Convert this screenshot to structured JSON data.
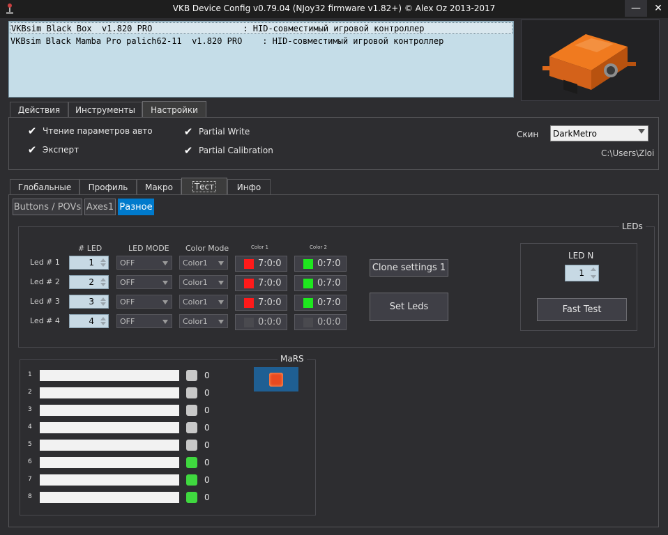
{
  "window": {
    "title": "VKB Device Config v0.79.04 (NJoy32 firmware v1.82+) © Alex Oz 2013-2017",
    "minimize_icon": "minimize-icon",
    "close_icon": "close-icon"
  },
  "devices": [
    {
      "text": "VKBsim Black Box  v1.820 PRO                  : HID-совместимый игровой контроллер"
    },
    {
      "text": "VKBsim Black Mamba Pro palich62-11  v1.820 PRO    : HID-совместимый игровой контроллер"
    }
  ],
  "main_tabs": [
    "Действия",
    "Инструменты",
    "Настройки"
  ],
  "settings": {
    "read_params_auto": "Чтение параметров авто",
    "expert": "Эксперт",
    "partial_write": "Partial Write",
    "partial_calibration": "Partial Calibration",
    "skin_label": "Скин",
    "skin_value": "DarkMetro",
    "path": "C:\\Users\\Zloi"
  },
  "sub_tabs": [
    "Глобальные",
    "Профиль",
    "Макро",
    "Тест",
    "Инфо"
  ],
  "test_tabs": [
    "Buttons / POVs",
    "Axes1",
    "Разное"
  ],
  "leds": {
    "group_title": "LEDs",
    "headers": {
      "num": "# LED",
      "mode": "LED MODE",
      "color_mode": "Color Mode",
      "color1": "Color 1",
      "color2": "Color 2"
    },
    "rows": [
      {
        "label": "Led # 1",
        "num": "1",
        "mode": "OFF",
        "color_mode": "Color1",
        "c1": "7:0:0",
        "c1_color": "#ff1a1a",
        "c2": "0:7:0",
        "c2_color": "#1ee81e"
      },
      {
        "label": "Led # 2",
        "num": "2",
        "mode": "OFF",
        "color_mode": "Color1",
        "c1": "7:0:0",
        "c1_color": "#ff1a1a",
        "c2": "0:7:0",
        "c2_color": "#1ee81e"
      },
      {
        "label": "Led # 3",
        "num": "3",
        "mode": "OFF",
        "color_mode": "Color1",
        "c1": "7:0:0",
        "c1_color": "#ff1a1a",
        "c2": "0:7:0",
        "c2_color": "#1ee81e"
      },
      {
        "label": "Led # 4",
        "num": "4",
        "mode": "OFF",
        "color_mode": "Color1",
        "c1": "0:0:0",
        "c1_color": "#4a4a4f",
        "c2": "0:0:0",
        "c2_color": "#4a4a4f"
      }
    ],
    "clone_button": "Clone settings 1",
    "set_button": "Set Leds",
    "led_n_label": "LED N",
    "led_n_value": "1",
    "fast_test_button": "Fast Test"
  },
  "mars": {
    "group_title": "MaRS",
    "rows": [
      {
        "num": "1",
        "value": "0",
        "led_color": "#c8c8c8"
      },
      {
        "num": "2",
        "value": "0",
        "led_color": "#c8c8c8"
      },
      {
        "num": "3",
        "value": "0",
        "led_color": "#c8c8c8"
      },
      {
        "num": "4",
        "value": "0",
        "led_color": "#c8c8c8"
      },
      {
        "num": "5",
        "value": "0",
        "led_color": "#c8c8c8"
      },
      {
        "num": "6",
        "value": "0",
        "led_color": "#3fd83f"
      },
      {
        "num": "7",
        "value": "0",
        "led_color": "#3fd83f"
      },
      {
        "num": "8",
        "value": "0",
        "led_color": "#3fd83f"
      }
    ]
  },
  "colors": {
    "accent": "#007acc",
    "list_bg": "#c5dde8",
    "bg": "#2d2d30"
  }
}
